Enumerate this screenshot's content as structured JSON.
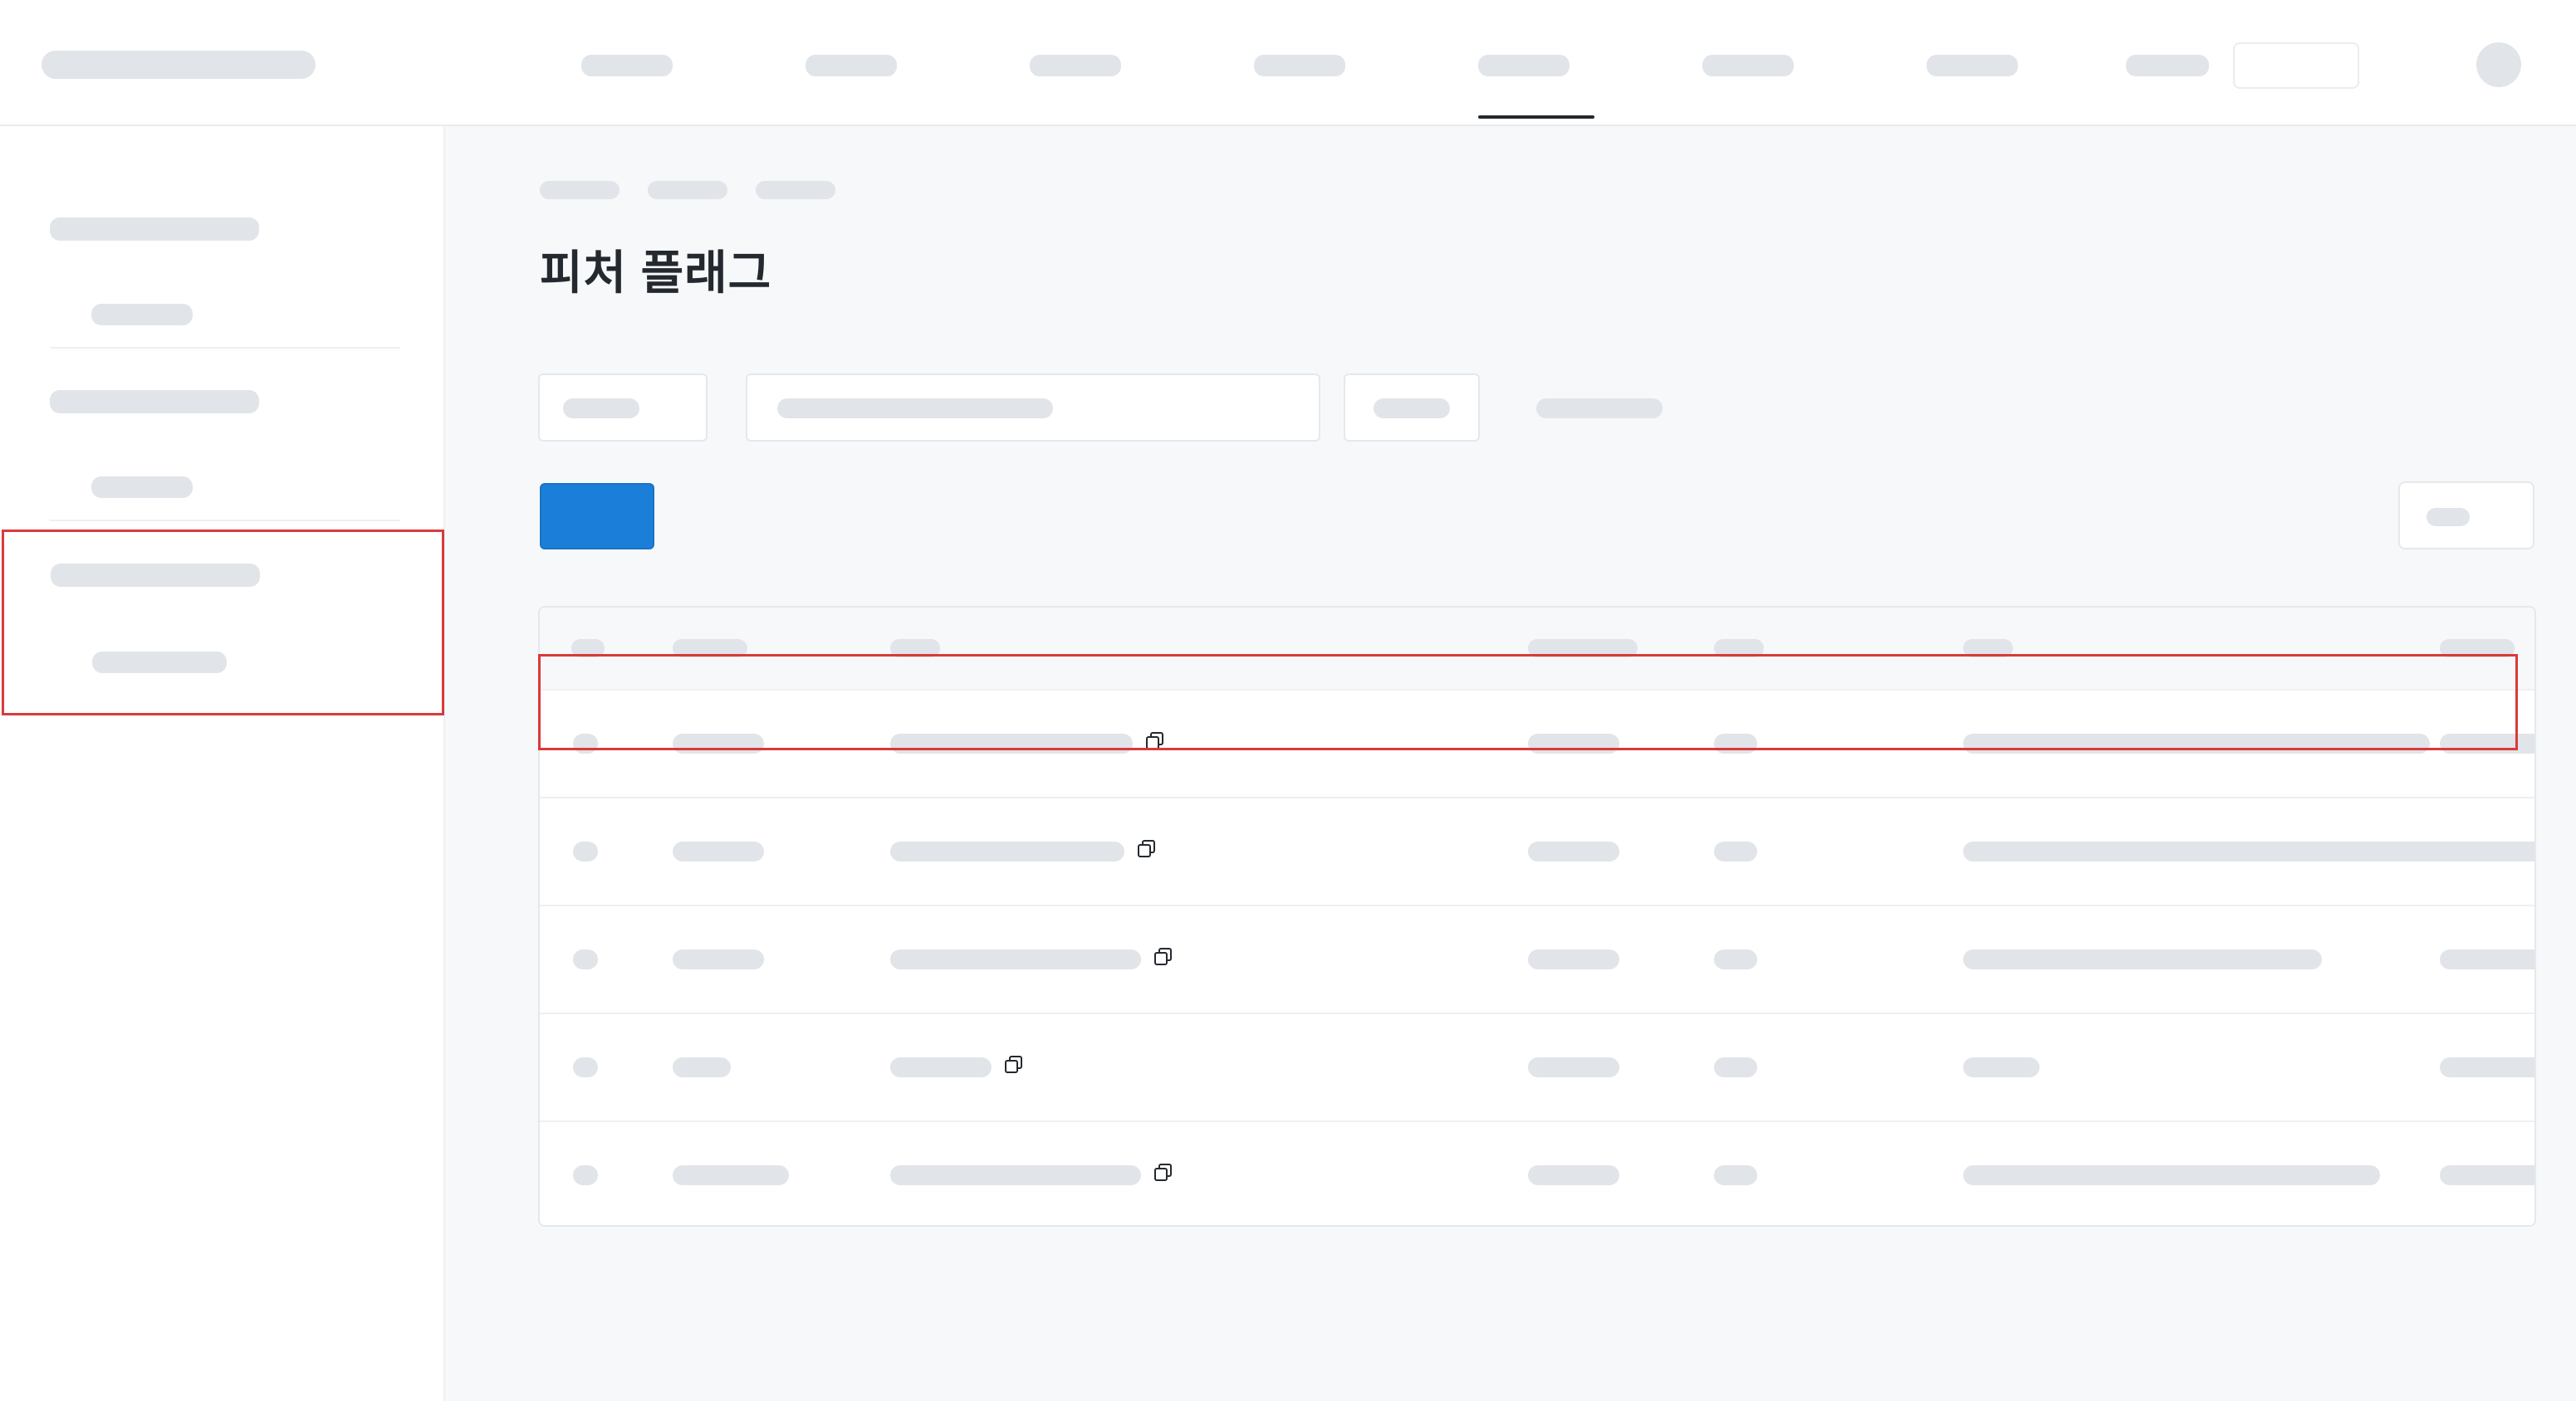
{
  "page": {
    "title": "피처 플래그"
  },
  "colors": {
    "primary": "#1b7fd9",
    "highlight": "#d93a3a",
    "placeholder": "#e1e4e8",
    "main_background": "#f6f8fa"
  },
  "nav": {
    "items_count": 8,
    "active_index": 4,
    "icons": [
      "avatar-icon"
    ]
  },
  "sidebar": {
    "sections_count": 3,
    "highlighted_section": 2
  },
  "table": {
    "rows_count": 5,
    "highlighted_row": 0,
    "icons": [
      "copy-icon"
    ]
  }
}
